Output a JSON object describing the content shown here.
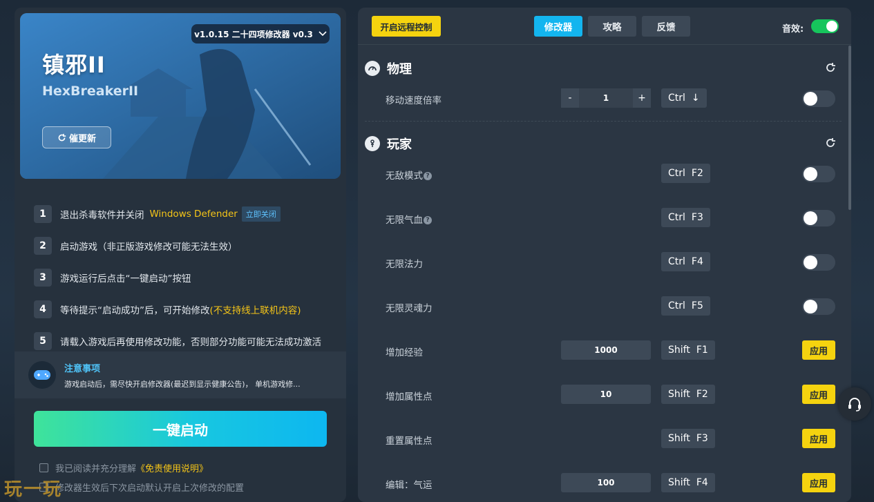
{
  "banner": {
    "version": "v1.0.15 二十四项修改器 v0.3",
    "title": "镇邪II",
    "subtitle": "HexBreakerII",
    "update_button": "催更新"
  },
  "steps": [
    {
      "num": "1",
      "text": "退出杀毒软件并关闭",
      "highlight": "Windows Defender",
      "action": "立即关闭"
    },
    {
      "num": "2",
      "text": "启动游戏（非正版游戏修改可能无法生效）"
    },
    {
      "num": "3",
      "text": "游戏运行后点击“一键启动”按钮"
    },
    {
      "num": "4",
      "text": "等待提示“启动成功”后，可开始修改",
      "highlight": "(不支持线上联机内容)"
    },
    {
      "num": "5",
      "text": "请载入游戏后再使用修改功能，否则部分功能可能无法成功激活"
    }
  ],
  "notice": {
    "title": "注意事项",
    "text": "游戏启动后，需尽快开启修改器(最迟到显示健康公告)， 单机游戏修..."
  },
  "launch_button": "一键启动",
  "checks": {
    "agree_prefix": "我已阅读并充分理解",
    "agree_link": "《免责使用说明》",
    "remember": "修改器生效后下次启动默认开启上次修改的配置"
  },
  "watermark": "玩一玩",
  "topbar": {
    "remote_button": "开启远程控制",
    "tabs": [
      "修改器",
      "攻略",
      "反馈"
    ],
    "sound_label": "音效:"
  },
  "sections": [
    {
      "title": "物理"
    },
    {
      "title": "玩家"
    }
  ],
  "rows": {
    "move_speed": {
      "label": "移动速度倍率",
      "value": "1",
      "minus": "-",
      "plus": "+",
      "key1": "Ctrl",
      "key2": "↓"
    },
    "invincible": {
      "label": "无敌模式",
      "key1": "Ctrl",
      "key2": "F2"
    },
    "inf_hp": {
      "label": "无限气血",
      "key1": "Ctrl",
      "key2": "F3"
    },
    "inf_mp": {
      "label": "无限法力",
      "key1": "Ctrl",
      "key2": "F4"
    },
    "inf_soul": {
      "label": "无限灵魂力",
      "key1": "Ctrl",
      "key2": "F5"
    },
    "add_exp": {
      "label": "增加经验",
      "value": "1000",
      "key1": "Shift",
      "key2": "F1",
      "apply": "应用"
    },
    "add_attr": {
      "label": "增加属性点",
      "value": "10",
      "key1": "Shift",
      "key2": "F2",
      "apply": "应用"
    },
    "reset_attr": {
      "label": "重置属性点",
      "key1": "Shift",
      "key2": "F3",
      "apply": "应用"
    },
    "edit_luck": {
      "label": "编辑：气运",
      "value": "100",
      "key1": "Shift",
      "key2": "F4",
      "apply": "应用"
    }
  },
  "colors": {
    "accent_blue": "#13b5ef",
    "accent_yellow": "#f5d30f",
    "toggle_on": "#16c55c",
    "highlight_text": "#f5c518"
  }
}
